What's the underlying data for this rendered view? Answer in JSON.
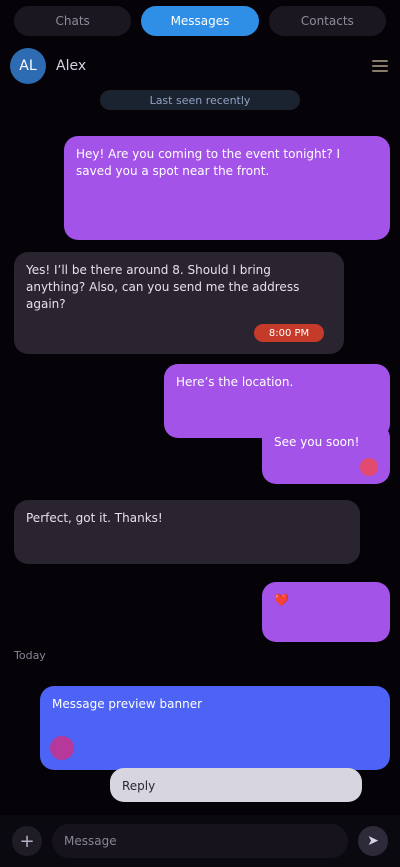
{
  "tabs": [
    {
      "label": "Chats",
      "active": false
    },
    {
      "label": "Messages",
      "active": true
    },
    {
      "label": "Contacts",
      "active": false
    }
  ],
  "header": {
    "avatar_initials": "AL",
    "title": "Alex",
    "subtitle": "Last seen recently",
    "menu_icon": "hamburger-icon"
  },
  "messages": [
    {
      "role": "out",
      "text": "Hey! Are you coming to the event tonight? I saved you a spot near the front."
    },
    {
      "role": "in",
      "text": "Yes! I’ll be there around 8. Should I bring anything? Also, can you send me the address again?",
      "time": "8:00 PM"
    },
    {
      "role": "out",
      "text": "Here’s the location."
    },
    {
      "role": "out",
      "text": "See you soon!"
    },
    {
      "role": "in",
      "text": "Perfect, got it. Thanks!"
    },
    {
      "role": "out",
      "text": "❤️"
    },
    {
      "role": "blue",
      "text": "Message preview banner"
    },
    {
      "role": "light",
      "text": "Reply"
    }
  ],
  "divider": "Today",
  "composer": {
    "placeholder": "Message",
    "plus_icon": "plus-icon",
    "send_icon": "send-icon"
  },
  "colors": {
    "accent": "#a353e8",
    "tab_active": "#2f8ee6",
    "blue_bubble": "#4c63f5"
  }
}
